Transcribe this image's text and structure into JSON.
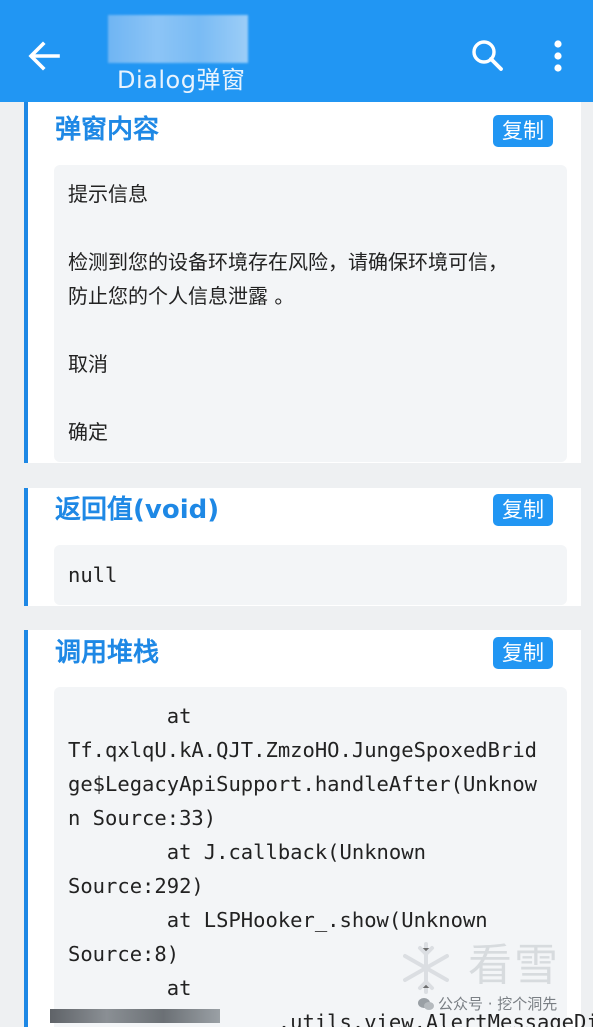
{
  "appbar": {
    "subtitle": "Dialog弹窗",
    "back_icon": "arrow-left-icon",
    "search_icon": "search-icon",
    "more_icon": "more-vert-icon",
    "color": "#2196f3"
  },
  "sections": {
    "dialog": {
      "title": "弹窗内容",
      "copy_label": "复制",
      "lines": [
        "提示信息",
        "检测到您的设备环境存在风险，请确保环境可信，",
        "防止您的个人信息泄露 。",
        "取消",
        "确定"
      ]
    },
    "returnval": {
      "title": "返回值(void)",
      "copy_label": "复制",
      "value": "null"
    },
    "stack": {
      "title": "调用堆栈",
      "copy_label": "复制",
      "lines": [
        "        at",
        "Tf.qxlqU.kA.QJT.ZmzoHO.JungeSpoxedBrid",
        "ge$LegacyApiSupport.handleAfter(Unknow",
        "n Source:33)",
        "        at J.callback(Unknown",
        "Source:292)",
        "        at LSPHooker_.show(Unknown",
        "Source:8)",
        "        at",
        "                 .utils.view.AlertMessageDi"
      ]
    }
  },
  "watermark": {
    "brand": "看雪",
    "account": "公众号 · 挖个洞先"
  },
  "accent_color": "#1e88e5"
}
